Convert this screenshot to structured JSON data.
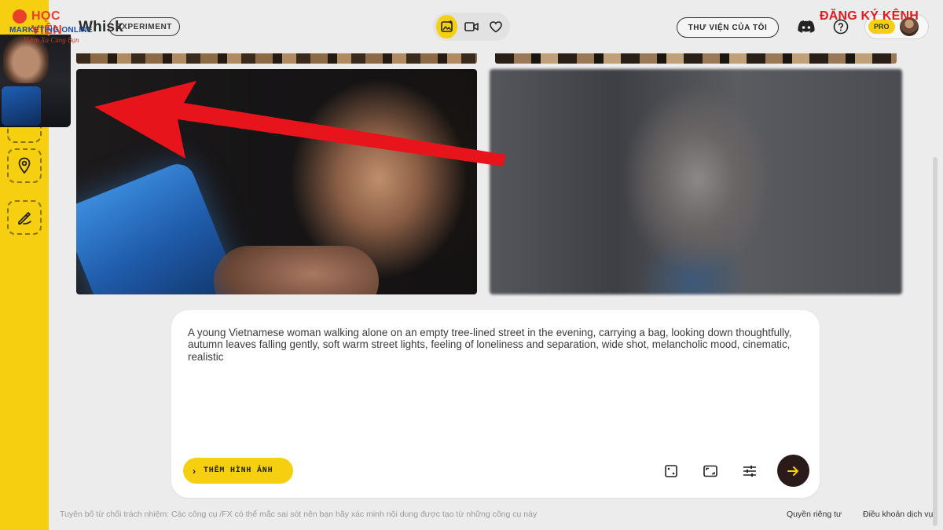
{
  "app": {
    "brand": "Whisk",
    "badge": "EXPERIMENT"
  },
  "header": {
    "library_button": "THƯ VIỆN CỦA TÔI",
    "pro_label": "PRO",
    "mode_icons": [
      "image-mode-icon",
      "video-mode-icon",
      "heart-icon"
    ]
  },
  "sidebar": {
    "tools": [
      "location-pin-icon",
      "brush-icon"
    ]
  },
  "prompt": {
    "text": "A young Vietnamese woman walking alone on an empty tree-lined street in the evening, carrying a bag, looking down thoughtfully, autumn leaves falling gently, soft warm street lights, feeling of loneliness and separation, wide shot, melancholic mood, cinematic, realistic",
    "add_image_label": "THÊM HÌNH ẢNH",
    "tools": [
      "dice-icon",
      "aspect-ratio-icon",
      "settings-sliders-icon"
    ]
  },
  "footer": {
    "disclaimer": "Tuyên bố từ chối trách nhiệm: Các công cụ /FX có thể mắc sai sót nên bạn hãy xác minh nội dung được tạo từ những công cụ này",
    "privacy": "Quyền riêng tư",
    "terms": "Điều khoản dịch vụ"
  },
  "watermarks": {
    "logo_line1": "HỌC VIỆN",
    "logo_line2": "MARKETING ONLINE",
    "logo_slogan": "Vươn Xa Cùng Bạn",
    "subscribe": "ĐĂNG KÝ KÊNH"
  },
  "colors": {
    "accent": "#f6cf10",
    "arrow": "#e8141c",
    "send_button": "#2a1a1a"
  }
}
